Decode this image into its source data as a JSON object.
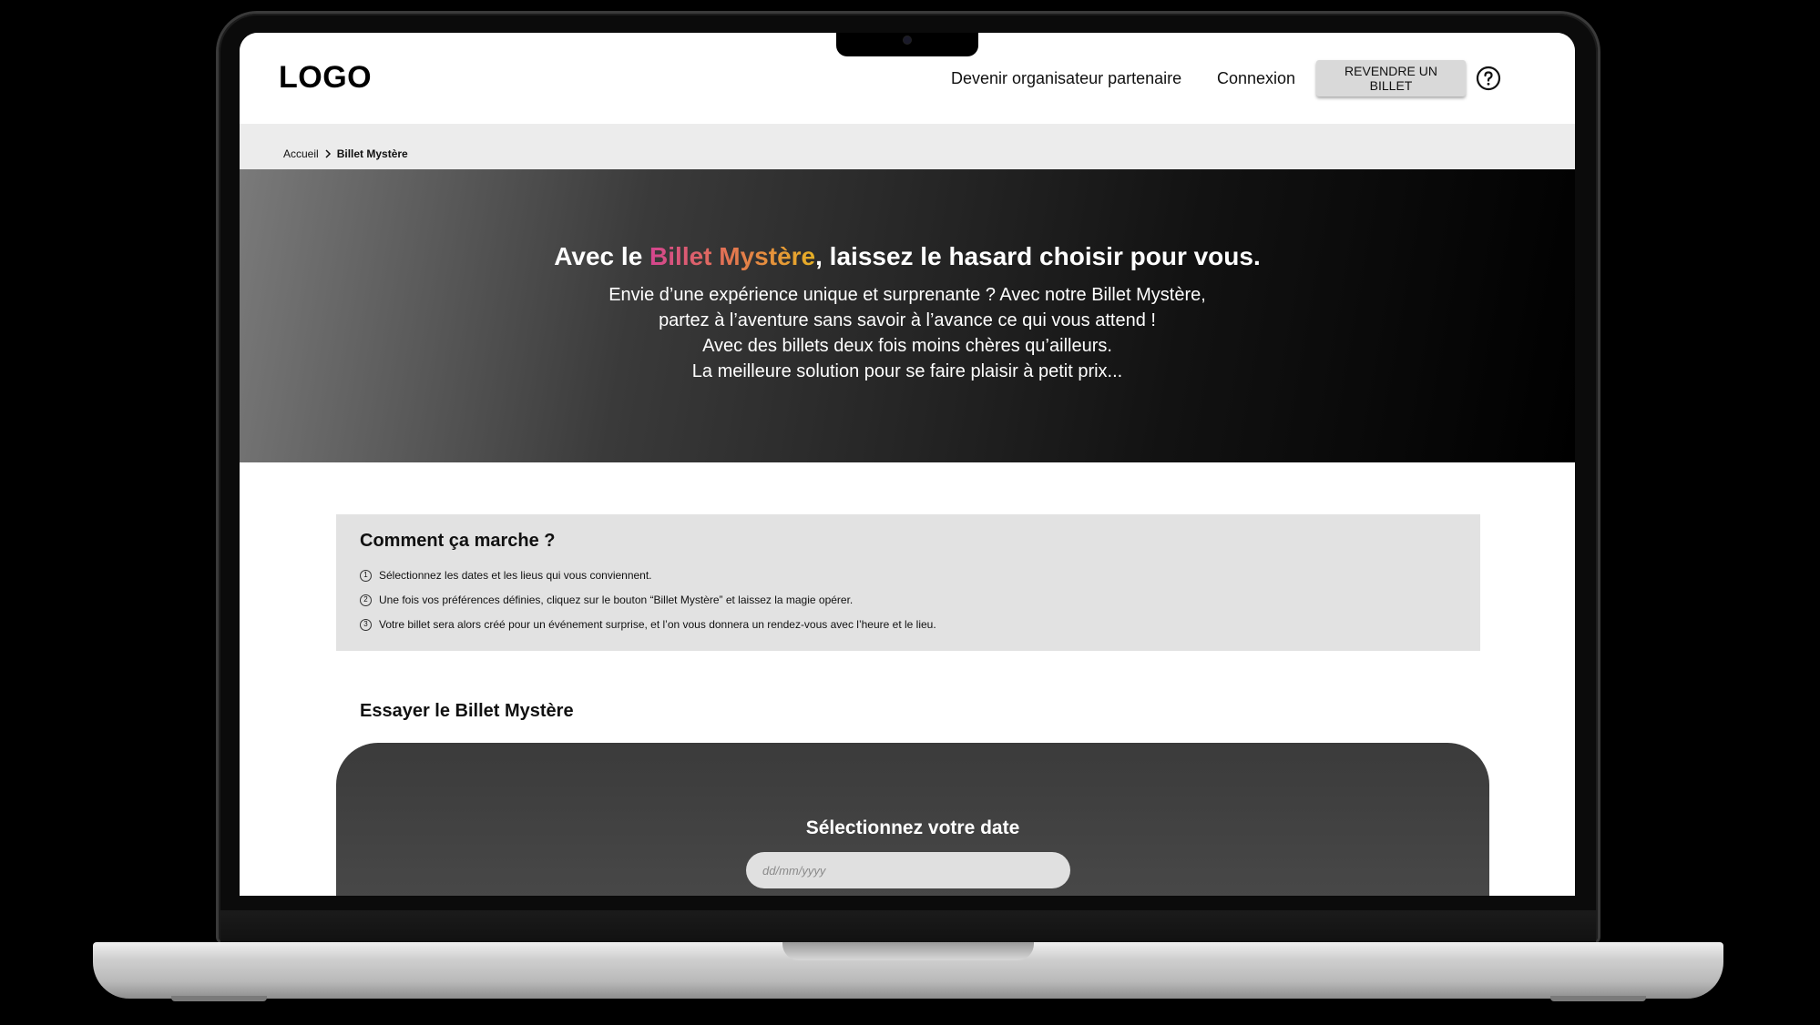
{
  "header": {
    "logo": "LOGO",
    "nav": {
      "partner": "Devenir organisateur partenaire",
      "login": "Connexion",
      "resell_button": "REVENDRE UN BILLET"
    },
    "help_icon": "question-circle-icon"
  },
  "breadcrumb": {
    "home": "Accueil",
    "separator_icon": "chevron-right-icon",
    "current": "Billet Mystère"
  },
  "hero": {
    "title_before": "Avec le ",
    "title_highlight": "Billet Mystère",
    "title_after": ", laissez le hasard choisir pour vous.",
    "highlight_colors": [
      "#d4458f",
      "#e4774f",
      "#e6b025"
    ],
    "lines": [
      "Envie d’une expérience unique et surprenante ? Avec notre Billet Mystère,",
      "partez à l’aventure sans savoir à l’avance ce qui vous attend !",
      "Avec des billets deux fois moins chères qu’ailleurs.",
      "La meilleure solution pour se faire plaisir à petit prix..."
    ]
  },
  "how_it_works": {
    "title": "Comment ça marche ?",
    "steps": [
      {
        "num": "1",
        "text": "Sélectionnez les dates et les lieus qui vous conviennent."
      },
      {
        "num": "2",
        "text": "Une fois vos préférences définies, cliquez sur le bouton “Billet Mystère” et laissez la magie opérer."
      },
      {
        "num": "3",
        "text": "Votre billet sera alors créé pour un événement surprise, et l’on vous donnera un rendez-vous avec l’heure et le lieu."
      }
    ]
  },
  "try_section": {
    "title": "Essayer le Billet Mystère",
    "date_label": "Sélectionnez votre date",
    "date_placeholder": "dd/mm/yyyy"
  }
}
